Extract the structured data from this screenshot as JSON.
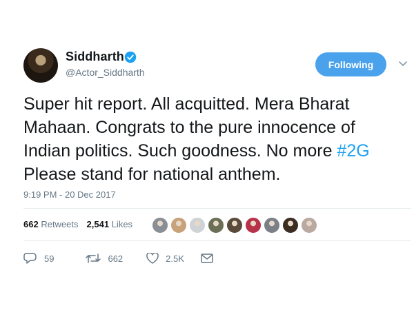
{
  "author": {
    "name": "Siddharth",
    "handle": "@Actor_Siddharth",
    "verified_icon": "verified-badge-icon",
    "avatar_icon": "profile-avatar"
  },
  "follow_button": {
    "label": "Following"
  },
  "menu": {
    "icon": "chevron-down-icon"
  },
  "tweet": {
    "lines": [
      "Super hit report. All acquitted. Mera Bharat",
      "Mahaan. Congrats to the pure innocence of",
      "Indian politics. Such goodness. No more "
    ],
    "hashtag": "#2G",
    "last_line": "Please stand for national anthem."
  },
  "timestamp": "9:19 PM - 20 Dec 2017",
  "stats": {
    "retweets_count": "662",
    "retweets_label": "Retweets",
    "likes_count": "2,541",
    "likes_label": "Likes"
  },
  "likers": [
    "#8a8f96",
    "#c8a27a",
    "#cfd3d6",
    "#6a6f55",
    "#5a4a3a",
    "#b8324a",
    "#7a7f88",
    "#3c2d22",
    "#b9a9a0"
  ],
  "actions": {
    "reply_count": "59",
    "retweet_count": "662",
    "like_count": "2.5K"
  },
  "colors": {
    "accent": "#1da1f2",
    "follow_bg": "#4aa1ec",
    "muted": "#657786"
  }
}
